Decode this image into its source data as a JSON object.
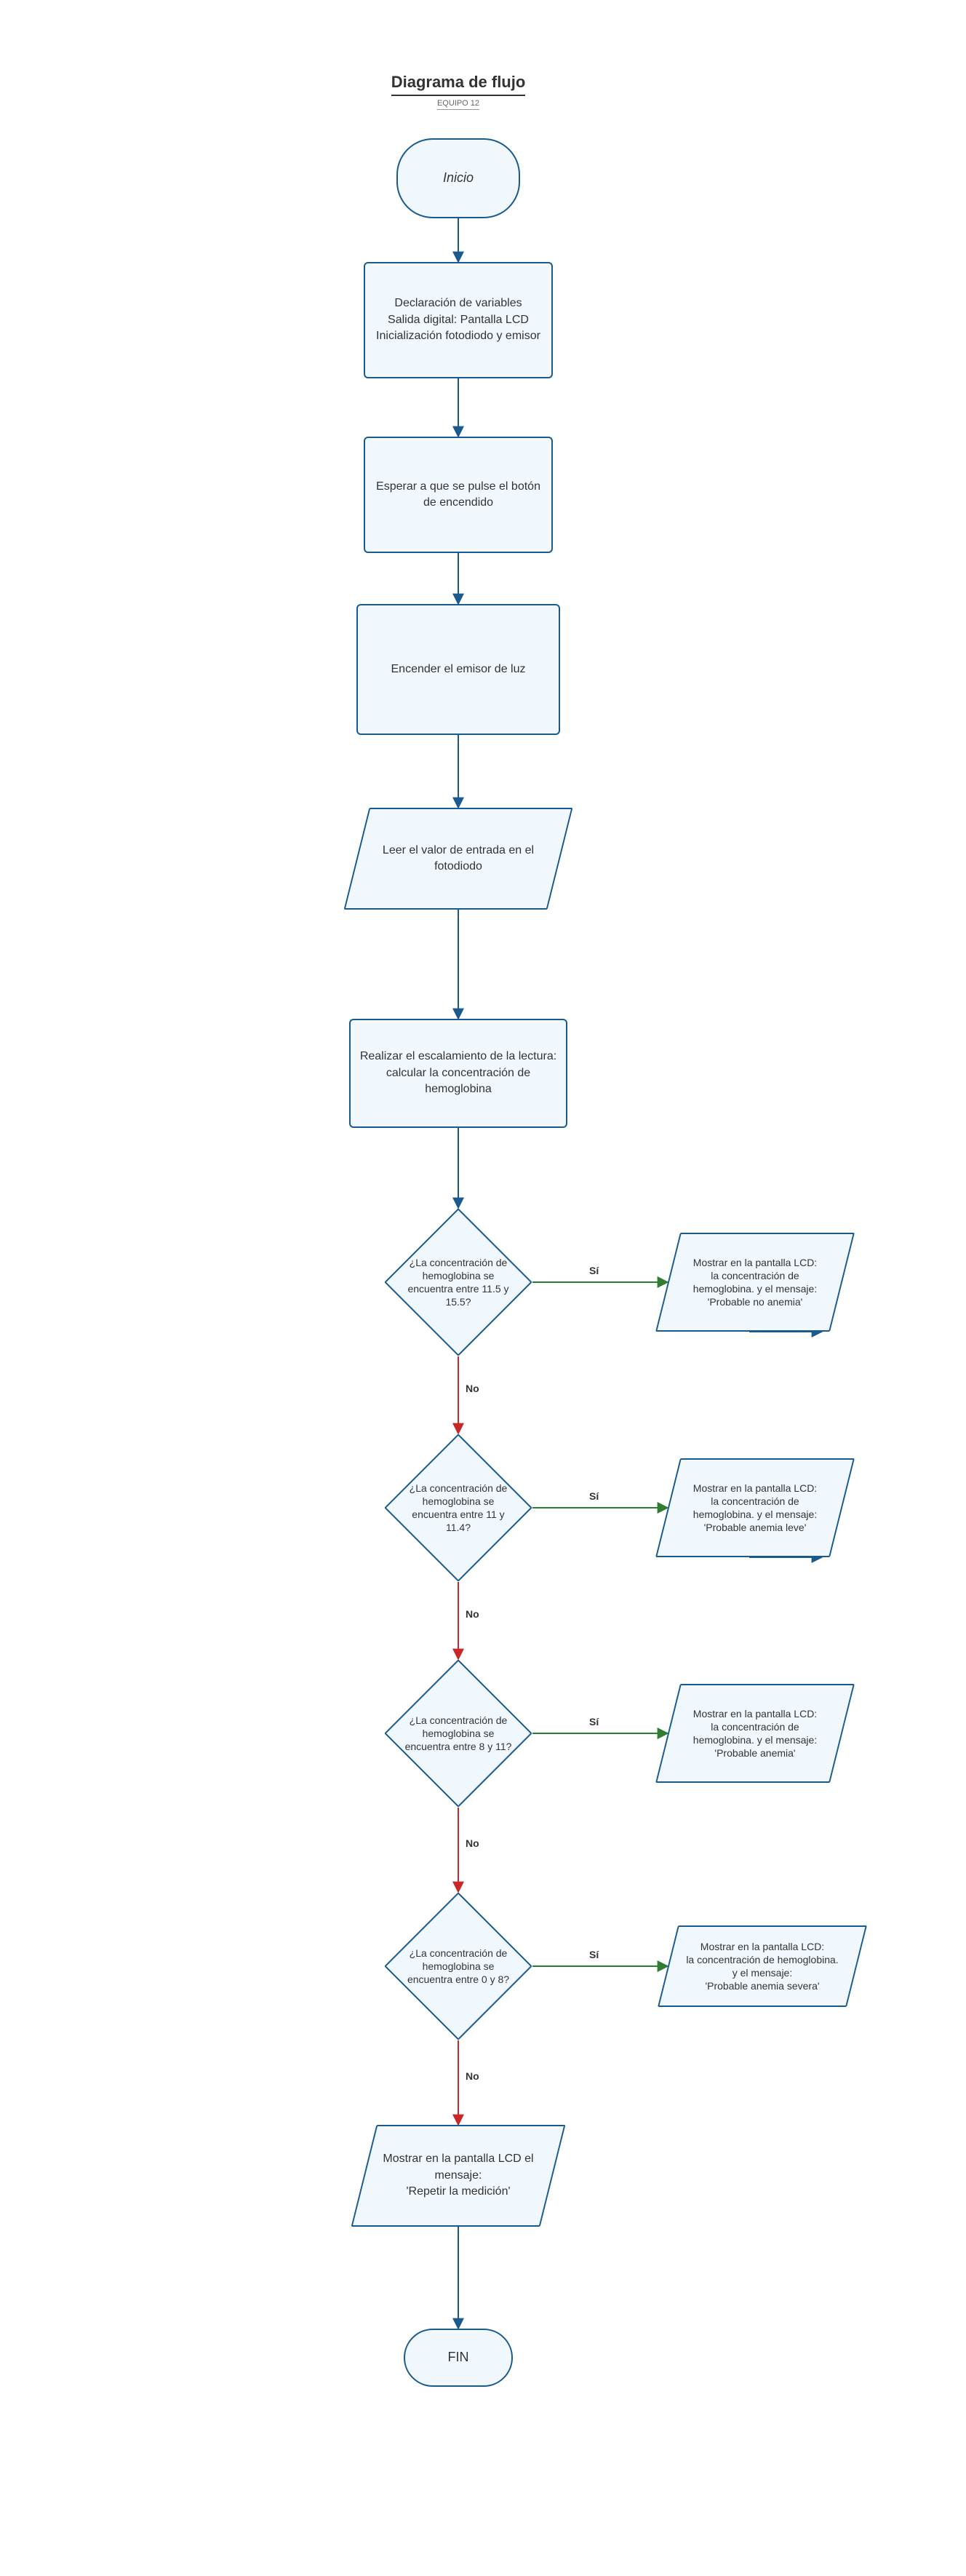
{
  "title": {
    "main": "Diagrama de flujo",
    "sub": "EQUIPO 12"
  },
  "nodes": {
    "start": "Inicio",
    "declare": "Declaración de variables\nSalida digital: Pantalla LCD\nInicialización fotodiodo y emisor",
    "wait_button": "Esperar a que se pulse el botón de encendido",
    "turn_on": "Encender el emisor de luz",
    "read_photodiode": "Leer el valor de entrada en el fotodiodo",
    "scale": "Realizar el escalamiento de la lectura: calcular la concentración de hemoglobina",
    "d1": "¿La concentración de hemoglobina se encuentra entre 11.5 y 15.5?",
    "d1_out": "Mostrar en la pantalla LCD:\nla concentración de hemoglobina. y el mensaje:\n'Probable no anemia'",
    "d2": "¿La concentración de hemoglobina se encuentra entre 11 y 11.4?",
    "d2_out": "Mostrar en la pantalla LCD:\nla concentración de hemoglobina. y el mensaje:\n'Probable anemia leve'",
    "d3": "¿La concentración de hemoglobina se encuentra entre 8 y 11?",
    "d3_out": "Mostrar en la pantalla LCD:\nla concentración de hemoglobina. y el mensaje:\n'Probable anemia'",
    "d4": "¿La concentración de hemoglobina se encuentra entre 0 y 8?",
    "d4_out": "Mostrar en la pantalla LCD:\nla concentración de hemoglobina. y el mensaje:\n'Probable anemia severa'",
    "repeat": "Mostrar en la pantalla LCD el mensaje:\n'Repetir la medición'",
    "end": "FIN"
  },
  "labels": {
    "yes": "Sí",
    "no": "No"
  }
}
